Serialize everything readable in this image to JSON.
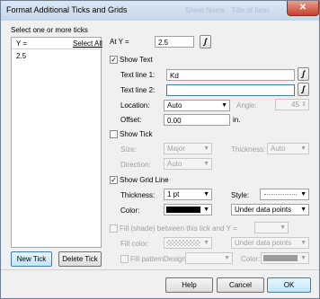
{
  "window": {
    "title": "Format Additional Ticks and Grids",
    "ghost_title": "Sheet Name · Title of Item"
  },
  "left": {
    "caption": "Select one or more ticks",
    "col_header": "Y =",
    "select_all": "Select All",
    "items": [
      "2.5"
    ],
    "new_tick": "New Tick",
    "delete_tick": "Delete Tick"
  },
  "at_y": {
    "label": "At Y =",
    "value": "2.5"
  },
  "show_text": {
    "label": "Show Text",
    "checked": true,
    "line1_label": "Text line 1:",
    "line1_value": "Kd",
    "line2_label": "Text line 2:",
    "line2_value": "",
    "location_label": "Location:",
    "location_value": "Auto",
    "angle_label": "Angle:",
    "angle_value": "45",
    "offset_label": "Offset:",
    "offset_value": "0.00",
    "offset_unit": "in."
  },
  "show_tick": {
    "label": "Show Tick",
    "checked": false,
    "size_label": "Size:",
    "size_value": "Major",
    "thickness_label": "Thickness:",
    "thickness_value": "Auto",
    "direction_label": "Direction:",
    "direction_value": "Auto"
  },
  "grid_line": {
    "label": "Show Grid Line",
    "checked": true,
    "thickness_label": "Thickness:",
    "thickness_value": "1 pt",
    "style_label": "Style:",
    "color_label": "Color:",
    "color_hex": "#000000",
    "layer_value": "Under data points"
  },
  "fill": {
    "label": "Fill (shade) between this tick and Y =",
    "color_label": "Fill color:",
    "layer_value": "Under data points",
    "pattern_label": "Fill pattern",
    "design_label": "Design:",
    "pcolor_label": "Color:"
  },
  "buttons": {
    "help": "Help",
    "cancel": "Cancel",
    "ok": "OK"
  }
}
